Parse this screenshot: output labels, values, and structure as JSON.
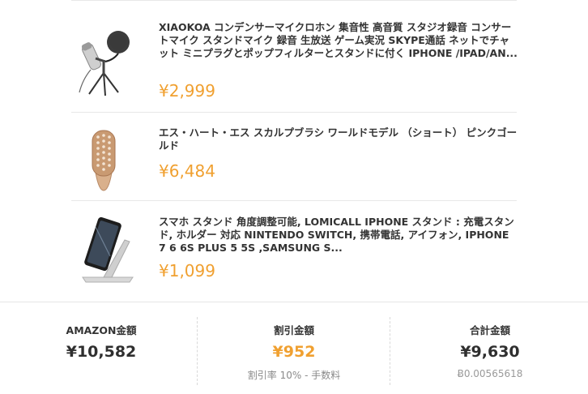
{
  "items": [
    {
      "title": "XIAOKOA コンデンサーマイクロホン 集音性 高音質 スタジオ録音 コンサートマイク スタンドマイク 録音 生放送 ゲーム実況 SKYPE通話 ネットでチャット ミニプラグとポップフィルターとスタンドに付く IPHONE /IPAD/AN...",
      "price": "¥2,999",
      "image": "condenser-microphone"
    },
    {
      "title": "エス・ハート・エス スカルプブラシ ワールドモデル （ショート） ピンクゴールド",
      "price": "¥6,484",
      "image": "scalp-brush"
    },
    {
      "title": "スマホ スタンド 角度調整可能, LOMICALL IPHONE スタンド : 充電スタンド, ホルダー 対応 NINTENDO SWITCH, 携帯電話, アイフォン, IPHONE 7 6 6S PLUS 5 5S ,SAMSUNG S...",
      "price": "¥1,099",
      "image": "phone-stand"
    }
  ],
  "summary": {
    "amazon": {
      "label": "AMAZON金額",
      "value": "¥10,582"
    },
    "discount": {
      "label": "割引金額",
      "value": "¥952",
      "note": "割引率 10% - 手数料"
    },
    "total": {
      "label": "合計金額",
      "value": "¥9,630",
      "btc": "Ƀ0.00565618"
    }
  },
  "colors": {
    "price": "#f0a030",
    "text": "#2f2f2f",
    "muted": "#8a8a8a"
  }
}
